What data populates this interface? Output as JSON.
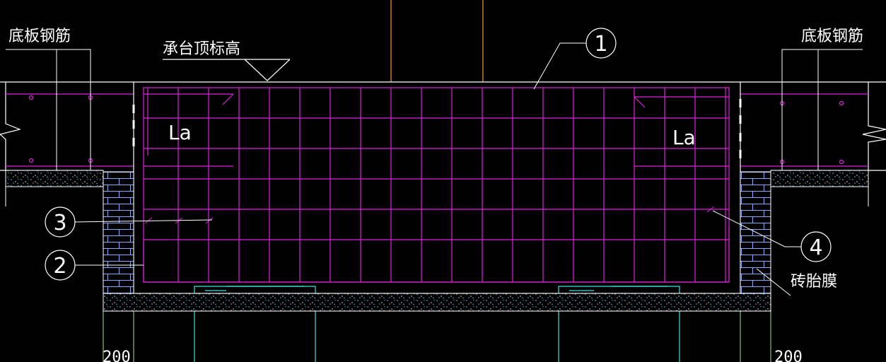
{
  "labels": {
    "slab_rebar_left": "底板钢筋",
    "slab_rebar_right": "底板钢筋",
    "cap_top_elev": "承台顶标高",
    "anchor_left": "La",
    "anchor_right": "La",
    "brick_membrane": "砖胎膜",
    "dim_left": "200",
    "dim_right": "200"
  },
  "callouts": [
    "1",
    "2",
    "3",
    "4"
  ],
  "colors": {
    "background": "#000000",
    "rebar": "#e020e0",
    "outline": "#ffffff",
    "axis": "#ff9933",
    "pile": "#40e0e0",
    "dimension": "#b0e080",
    "concrete_dot": "#66ccff"
  }
}
